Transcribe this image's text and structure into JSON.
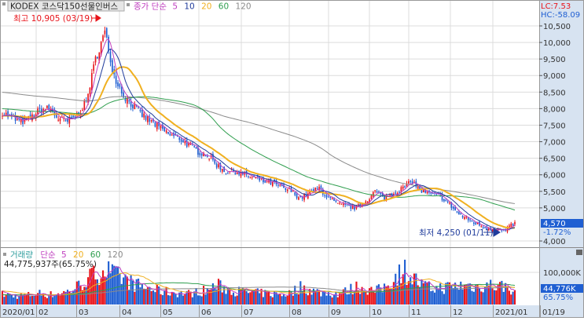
{
  "header": {
    "title": "KODEX 코스닥150선물인버스",
    "price_legend_label": "종가 단순",
    "ma_periods": [
      "5",
      "10",
      "20",
      "60",
      "120"
    ],
    "lc": "LC:7.53",
    "hc": "HC:-58.09"
  },
  "annotations": {
    "high": "최고 10,905 (03/19)",
    "low": "최저 4,250 (01/11)"
  },
  "price_badge": {
    "value": "4,570",
    "change": "-1.72%"
  },
  "volume": {
    "legend_label": "거래량",
    "ma_label": "단순",
    "ma_periods": [
      "5",
      "20",
      "60",
      "120"
    ],
    "current_text": "44,775,937주(65.75%)",
    "badge_value": "44,776K",
    "badge_pct": "65.75%",
    "axis_label": "100,000K"
  },
  "colors": {
    "up": "#e8141b",
    "down": "#1f5fd2",
    "ma5": "#c040c0",
    "ma10": "#203c9c",
    "ma20": "#f0b020",
    "ma60": "#2f9e4e",
    "ma120": "#8a8a8a",
    "axis_bg": "#d7e3f1"
  },
  "chart_data": {
    "type": "candlestick",
    "title": "KODEX 코스닥150선물인버스",
    "y_ticks": [
      "10,500",
      "10,000",
      "9,500",
      "9,000",
      "8,500",
      "8,000",
      "7,500",
      "7,000",
      "6,500",
      "6,000",
      "5,500",
      "5,000",
      "4,000"
    ],
    "ylim": [
      4000,
      10500
    ],
    "x_ticks": [
      "2020/01",
      "02",
      "03",
      "04",
      "05",
      "06",
      "07",
      "08",
      "09",
      "10",
      "11",
      "12",
      "2021/01",
      "01/19"
    ],
    "weekly_close": [
      7900,
      7700,
      7600,
      7700,
      7950,
      8000,
      7700,
      7600,
      7800,
      8200,
      9500,
      10300,
      9000,
      8400,
      8100,
      7800,
      7600,
      7400,
      7200,
      7100,
      6900,
      6700,
      6600,
      6300,
      6100,
      6100,
      6000,
      5900,
      5800,
      5750,
      5600,
      5500,
      5300,
      5450,
      5600,
      5300,
      5100,
      5050,
      5000,
      5200,
      5500,
      5300,
      5450,
      5600,
      5800,
      5500,
      5400,
      5350,
      5100,
      4800,
      4650,
      4500,
      4400,
      4350,
      4300,
      4570
    ],
    "weekly_volume_k": [
      32000,
      28000,
      27000,
      30000,
      35000,
      30000,
      34000,
      40000,
      55000,
      75000,
      95000,
      110000,
      90000,
      80000,
      65000,
      55000,
      48000,
      42000,
      38000,
      36000,
      34000,
      40000,
      45000,
      60000,
      50000,
      42000,
      40000,
      37000,
      35000,
      33000,
      32000,
      36000,
      55000,
      45000,
      38000,
      35000,
      33000,
      42000,
      55000,
      50000,
      40000,
      55000,
      80000,
      110000,
      85000,
      60000,
      50000,
      52000,
      55000,
      58000,
      60000,
      55000,
      62000,
      58000,
      56000,
      44776
    ],
    "ma120_start": 8500
  }
}
